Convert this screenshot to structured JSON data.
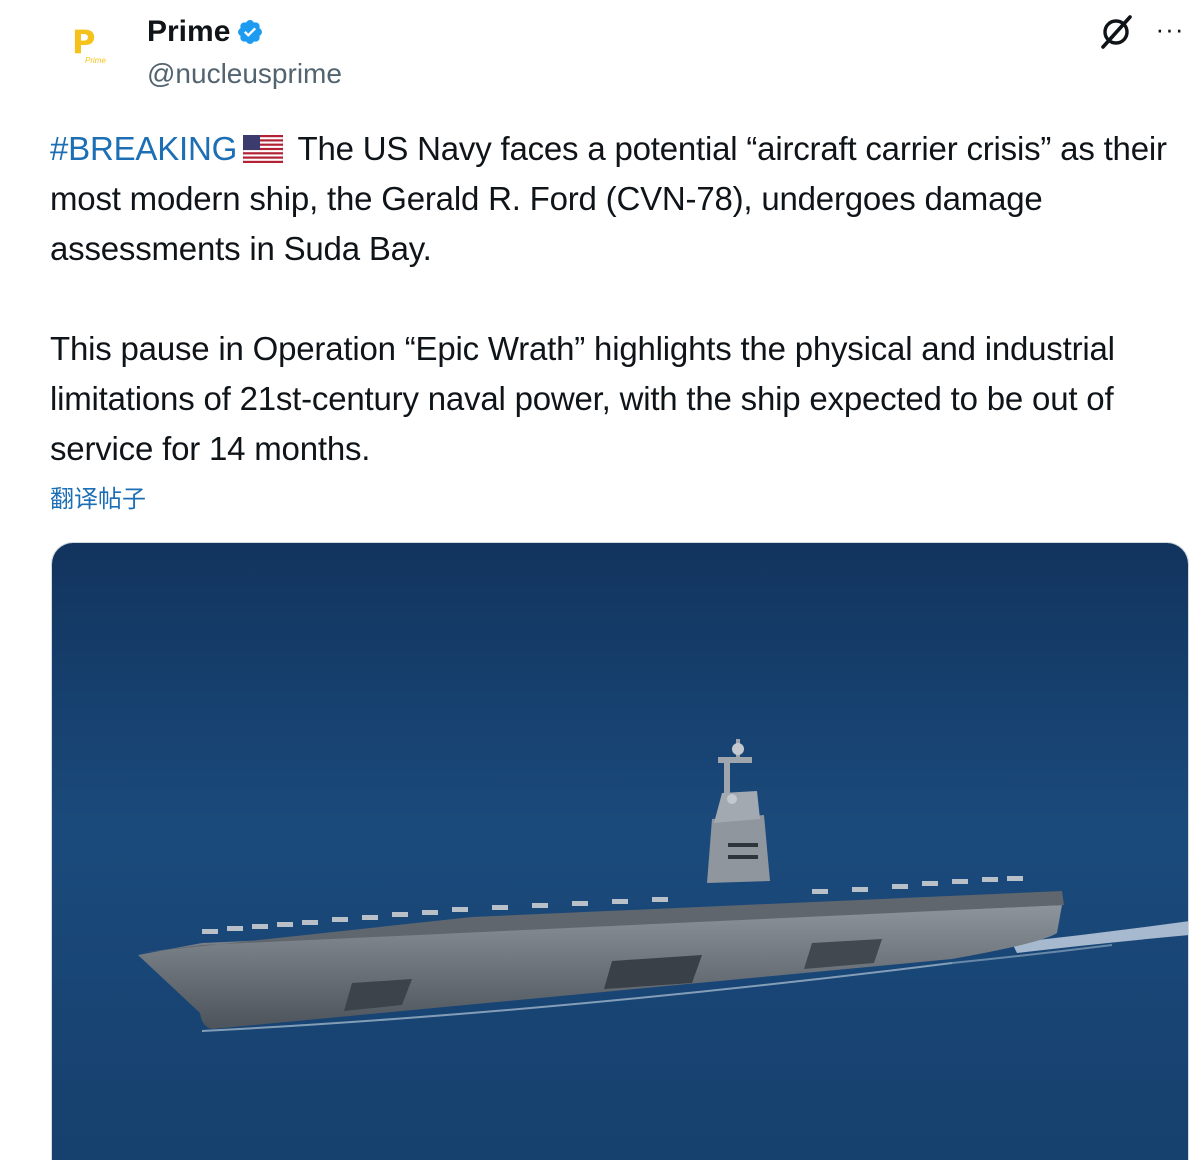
{
  "tweet": {
    "author": {
      "display_name": "Prime",
      "handle": "@nucleusprime",
      "verified": true,
      "avatar_letter": "P",
      "avatar_sub": "Prime"
    },
    "header_icons": [
      "grok-icon",
      "more-icon"
    ],
    "more_label": "···",
    "text": {
      "hashtag": "#BREAKING",
      "flag": "us-flag",
      "line1_rest": " The US Navy faces a potential “aircraft carrier crisis” as their most modern ship, the Gerald R. Ford (CVN-78), undergoes damage assessments in Suda Bay.",
      "paragraph2": "This pause in Operation “Epic Wrath” highlights the physical and industrial limitations of 21st-century naval power, with the ship expected to be out of service for 14 months."
    },
    "translate_label": "翻译帖子",
    "media": {
      "description_icon": "aircraft-carrier-photo"
    }
  },
  "colors": {
    "link_blue": "#1d6fb5",
    "verified_blue": "#1d9bf0",
    "text": "#0f1419",
    "muted": "#536471",
    "avatar_gold": "#f4c21b",
    "sea": "#1a4472"
  }
}
